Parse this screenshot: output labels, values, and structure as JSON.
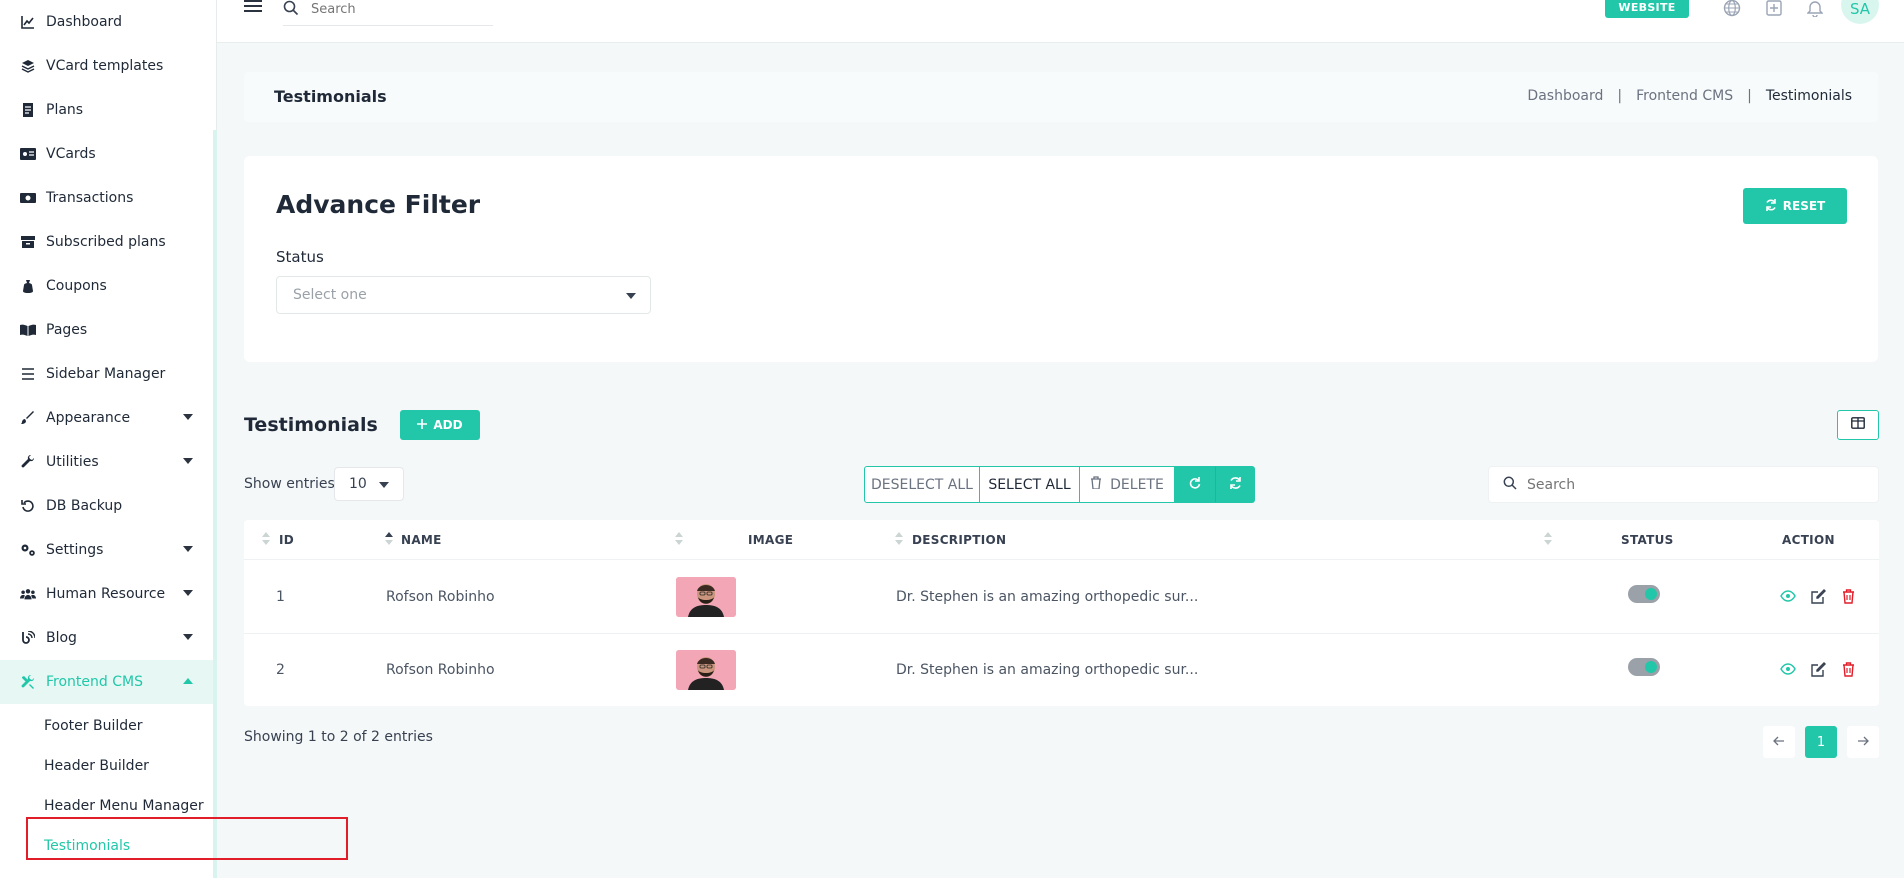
{
  "sidebar": {
    "items": [
      {
        "label": "Dashboard",
        "icon": "chart-line-icon"
      },
      {
        "label": "VCard templates",
        "icon": "layers-icon"
      },
      {
        "label": "Plans",
        "icon": "document-icon"
      },
      {
        "label": "VCards",
        "icon": "id-card-icon"
      },
      {
        "label": "Transactions",
        "icon": "money-icon"
      },
      {
        "label": "Subscribed plans",
        "icon": "archive-icon"
      },
      {
        "label": "Coupons",
        "icon": "money-bag-icon"
      },
      {
        "label": "Pages",
        "icon": "book-icon"
      },
      {
        "label": "Sidebar Manager",
        "icon": "list-icon"
      },
      {
        "label": "Appearance",
        "icon": "brush-icon"
      },
      {
        "label": "Utilities",
        "icon": "wrench-icon"
      },
      {
        "label": "DB Backup",
        "icon": "undo-icon"
      },
      {
        "label": "Settings",
        "icon": "cogs-icon"
      },
      {
        "label": "Human Resource",
        "icon": "users-icon"
      },
      {
        "label": "Blog",
        "icon": "blog-icon"
      },
      {
        "label": "Frontend CMS",
        "icon": "tools-icon"
      }
    ],
    "sub_items": [
      "Footer Builder",
      "Header Builder",
      "Header Menu Manager",
      "Testimonials"
    ]
  },
  "topbar": {
    "search_placeholder": "Search",
    "website_label": "WEBSITE",
    "avatar_initials": "SA"
  },
  "page": {
    "title": "Testimonials",
    "breadcrumb": [
      "Dashboard",
      "Frontend CMS",
      "Testimonials"
    ]
  },
  "filter": {
    "title": "Advance Filter",
    "status_label": "Status",
    "status_placeholder": "Select one",
    "reset_label": "RESET"
  },
  "table_section": {
    "title": "Testimonials",
    "add_label": "ADD",
    "show_label": "Show entries",
    "entries_value": "10",
    "deselect_label": "DESELECT ALL",
    "select_label": "SELECT ALL",
    "delete_label": "DELETE",
    "search_placeholder": "Search",
    "columns": [
      "ID",
      "NAME",
      "IMAGE",
      "DESCRIPTION",
      "STATUS",
      "ACTION"
    ],
    "rows": [
      {
        "id": "1",
        "name": "Rofson Robinho",
        "description": "Dr. Stephen is an amazing orthopedic sur..."
      },
      {
        "id": "2",
        "name": "Rofson Robinho",
        "description": "Dr. Stephen is an amazing orthopedic sur..."
      }
    ],
    "showing": "Showing 1 to 2 of 2 entries",
    "current_page": "1"
  },
  "colors": {
    "accent": "#22c7a9",
    "danger": "#e11d2a"
  }
}
